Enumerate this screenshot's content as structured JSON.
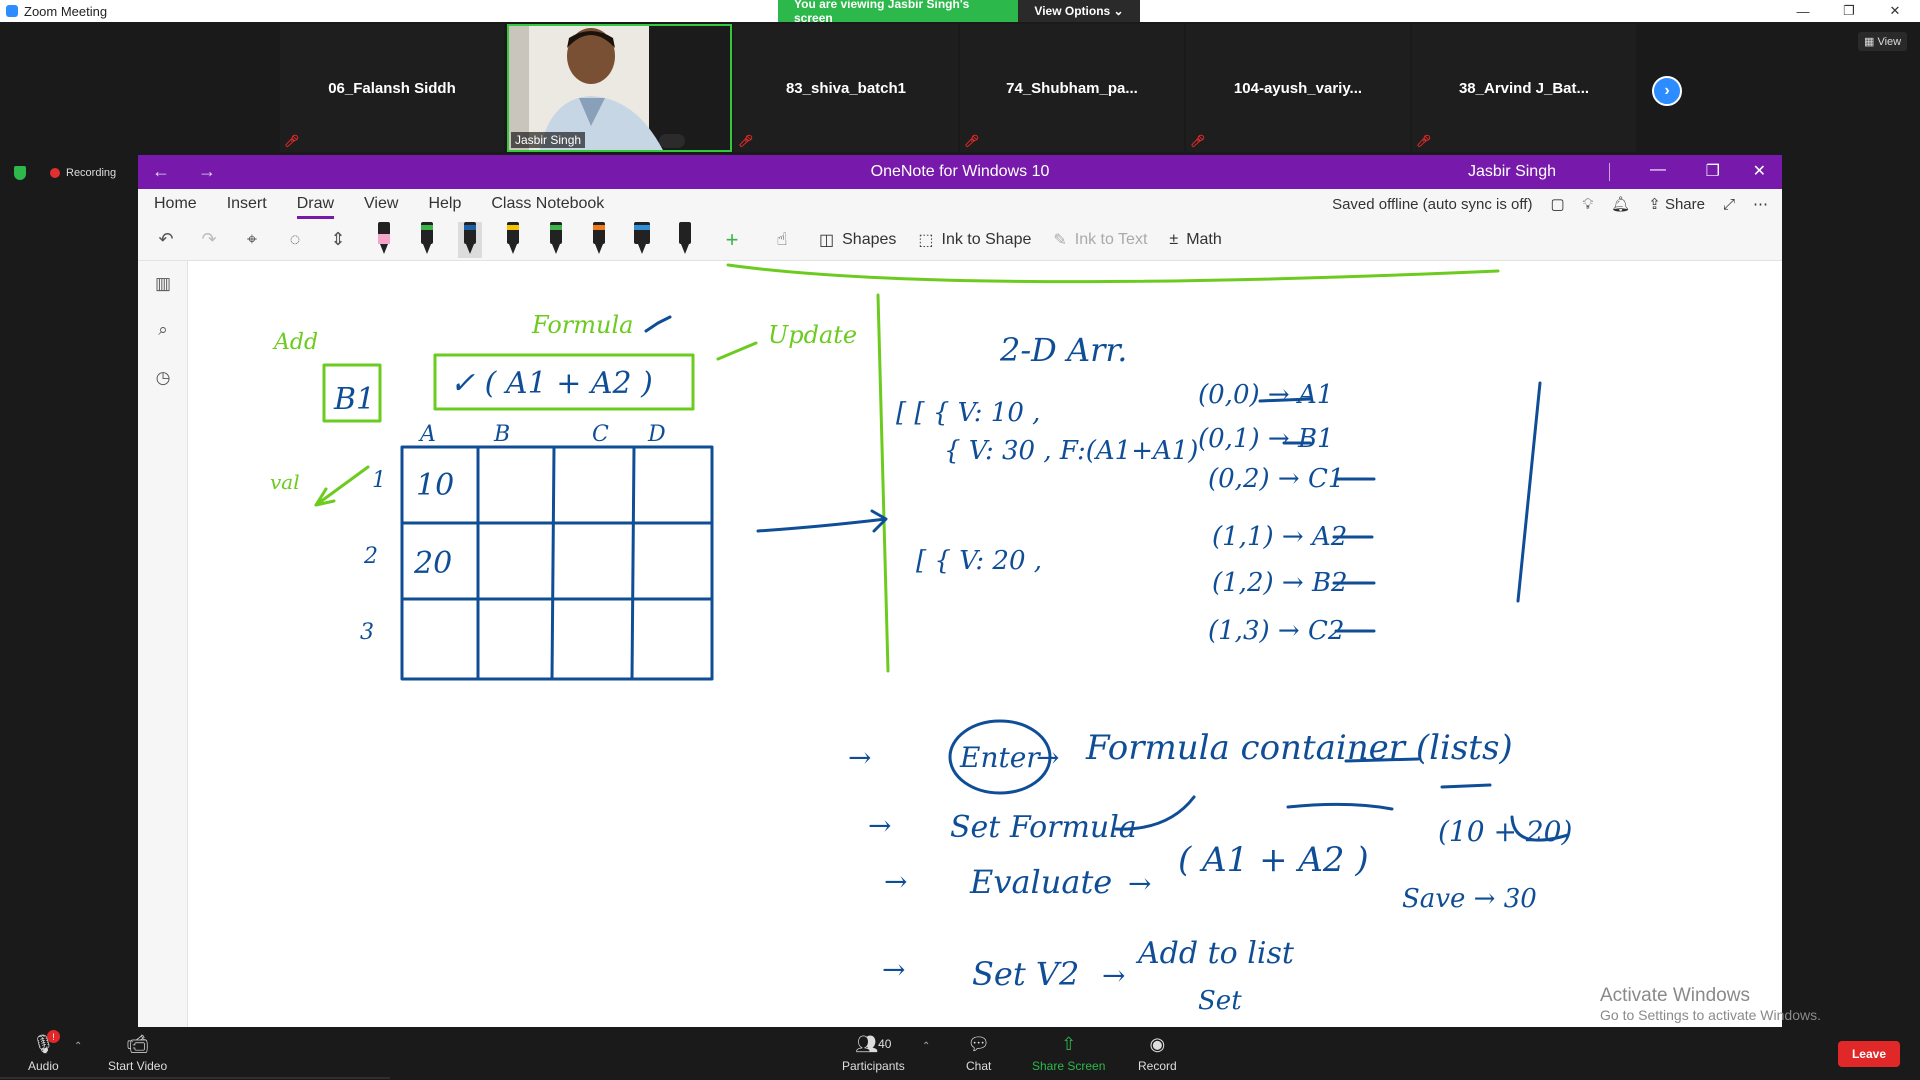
{
  "zoom": {
    "window_title": "Zoom Meeting",
    "share_banner": "You are viewing Jasbir Singh's screen",
    "view_options": "View Options ⌄",
    "view_label": "View",
    "recording": "Recording",
    "participants": [
      {
        "name": "06_Falansh Siddh"
      },
      {
        "name": "83_shiva_batch1"
      },
      {
        "name": "74_Shubham_pa..."
      },
      {
        "name": "104-ayush_variy..."
      },
      {
        "name": "38_Arvind J_Bat..."
      }
    ],
    "video_tile_name": "Jasbir Singh",
    "bottom": {
      "audio": "Audio",
      "audio_badge": "!",
      "start_video": "Start Video",
      "participants": "Participants",
      "participant_count": "40",
      "chat": "Chat",
      "share_screen": "Share Screen",
      "record": "Record",
      "leave": "Leave"
    }
  },
  "onenote": {
    "title": "OneNote for Windows 10",
    "user": "Jasbir Singh",
    "tabs": [
      "Home",
      "Insert",
      "Draw",
      "View",
      "Help",
      "Class Notebook"
    ],
    "active_tab": "Draw",
    "sync_status": "Saved offline (auto sync is off)",
    "share": "Share",
    "tools": {
      "shapes": "Shapes",
      "ink_to_shape": "Ink to Shape",
      "ink_to_text": "Ink to Text",
      "math": "Math"
    },
    "pen_colors": [
      "#f4a6c8",
      "#3bb54a",
      "#1b5fa8",
      "#f5c400",
      "#3bb54a",
      "#f07b1e",
      "#2f8fd8",
      "#222222"
    ],
    "ink_colors": {
      "green": "#6ccb1f",
      "blue": "#0f4e96"
    },
    "ink_text": {
      "cell_ref": "B1",
      "formula": "✓ ( A1 + A2 )",
      "col_headers": [
        "A",
        "B",
        "C",
        "D"
      ],
      "row_headers": [
        "1",
        "2",
        "3"
      ],
      "cell_a1": "10",
      "cell_a2": "20",
      "title_2d": "2-D Arr.",
      "enter": "Enter",
      "formula_container": "Formula container (lists)",
      "set_formula": "Set Formula",
      "evaluate": "Evaluate",
      "eval_expr": "( A1 + A2 )",
      "eval_result": "(10 + 20)",
      "save": "Save → 30",
      "set_v2": "Set V2",
      "add_to_list": "Add to list",
      "set_low": "Set",
      "scribble_left": "Add",
      "scribble_formula": "Formula",
      "scribble_update": "Update",
      "scribble_val": "val",
      "arr_line1": "[ [ { V: 10 ,",
      "arr_line2": "{ V: 30 , F:(A1+A1)",
      "arr_line3": "[ { V: 20 ,",
      "idx": [
        "(0,0) → A1",
        "(0,1) → B1",
        "(0,2) → C1",
        "(1,1) → A2",
        "(1,2) → B2",
        "(1,3) → C2"
      ]
    },
    "watermark": {
      "line1": "Activate Windows",
      "line2": "Go to Settings to activate Windows."
    }
  }
}
